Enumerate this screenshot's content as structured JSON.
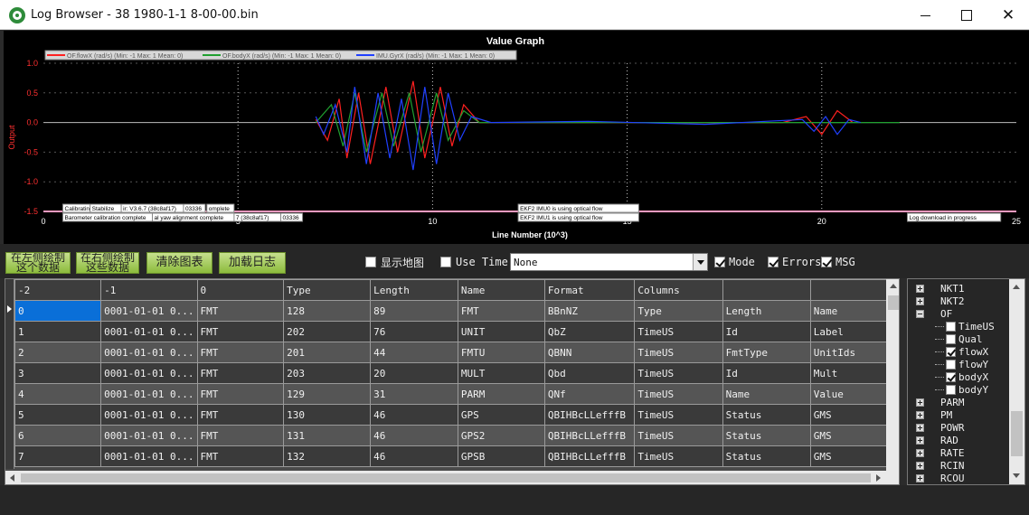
{
  "window": {
    "title": "Log Browser - 38 1980-1-1 8-00-00.bin",
    "close_glyph": "✕"
  },
  "graph": {
    "chart_data": {
      "type": "line",
      "title": "Value Graph",
      "xlabel": "Line Number (10^3)",
      "ylabel": "Output",
      "xlim": [
        0,
        25
      ],
      "ylim": [
        -1.5,
        1.0
      ],
      "x_ticks": [
        "0",
        "5",
        "10",
        "15",
        "20",
        "25"
      ],
      "y_ticks": [
        "1.0",
        "0.5",
        "0.0",
        "-0.5",
        "-1.0",
        "-1.5"
      ],
      "grid": true,
      "legend_position": "top-left",
      "series": [
        {
          "name": "OF.flowX (rad/s) (Min: -1 Max: 1 Mean: 0)",
          "color": "#ff2020",
          "points": [
            [
              7.0,
              0.05
            ],
            [
              7.3,
              -0.3
            ],
            [
              7.6,
              0.4
            ],
            [
              7.8,
              -0.6
            ],
            [
              8.1,
              0.5
            ],
            [
              8.4,
              -0.7
            ],
            [
              8.8,
              0.6
            ],
            [
              9.1,
              -0.5
            ],
            [
              9.5,
              0.7
            ],
            [
              9.8,
              -0.6
            ],
            [
              10.2,
              0.6
            ],
            [
              10.5,
              -0.4
            ],
            [
              10.8,
              0.3
            ],
            [
              11.2,
              0.0
            ],
            [
              13,
              0.0
            ],
            [
              15,
              0.0
            ],
            [
              17,
              0.0
            ],
            [
              19,
              0.0
            ],
            [
              19.6,
              0.1
            ],
            [
              20.0,
              -0.2
            ],
            [
              20.4,
              0.2
            ],
            [
              20.8,
              0.0
            ]
          ]
        },
        {
          "name": "OF.bodyX (rad/s) (Min: -1 Max: 1 Mean: 0)",
          "color": "#20a030",
          "points": [
            [
              7.0,
              0.0
            ],
            [
              7.4,
              0.3
            ],
            [
              7.7,
              -0.4
            ],
            [
              8.0,
              0.5
            ],
            [
              8.3,
              -0.5
            ],
            [
              8.7,
              0.5
            ],
            [
              9.0,
              -0.4
            ],
            [
              9.4,
              0.5
            ],
            [
              9.7,
              -0.5
            ],
            [
              10.1,
              0.5
            ],
            [
              10.4,
              -0.3
            ],
            [
              10.8,
              0.2
            ],
            [
              11.2,
              0.0
            ],
            [
              22,
              0.0
            ]
          ]
        },
        {
          "name": "IMU.GyrX (rad/s) (Min: -1 Max: 1 Mean: 0)",
          "color": "#2040ff",
          "points": [
            [
              7.0,
              0.1
            ],
            [
              7.2,
              -0.2
            ],
            [
              7.5,
              0.3
            ],
            [
              7.8,
              -0.5
            ],
            [
              8.0,
              0.6
            ],
            [
              8.3,
              -0.7
            ],
            [
              8.6,
              0.5
            ],
            [
              8.9,
              -0.6
            ],
            [
              9.2,
              0.4
            ],
            [
              9.5,
              -0.8
            ],
            [
              9.8,
              0.6
            ],
            [
              10.1,
              -0.7
            ],
            [
              10.4,
              0.5
            ],
            [
              10.7,
              -0.3
            ],
            [
              11.0,
              0.1
            ],
            [
              11.5,
              0.0
            ],
            [
              14,
              0.02
            ],
            [
              17,
              -0.03
            ],
            [
              19.5,
              0.05
            ],
            [
              19.8,
              -0.15
            ],
            [
              20.1,
              0.1
            ],
            [
              20.4,
              -0.2
            ],
            [
              20.7,
              0.05
            ],
            [
              21.0,
              0.0
            ]
          ]
        }
      ],
      "annotations": [
        {
          "x": 0.5,
          "text": "Calibrating"
        },
        {
          "x": 1.2,
          "text": "Stabilize"
        },
        {
          "x": 2.0,
          "text": "ir: V3.6.7 (38c8af17)"
        },
        {
          "x": 3.6,
          "text": "03336"
        },
        {
          "x": 4.2,
          "text": "omplete"
        },
        {
          "x": 0.5,
          "text": "Barometer calibration complete"
        },
        {
          "x": 2.8,
          "text": "al yaw alignment complete"
        },
        {
          "x": 4.9,
          "text": "7 (38c8af17)"
        },
        {
          "x": 6.1,
          "text": "03336"
        },
        {
          "x": 12.2,
          "text": "EKF2 IMU0 is using optical flow"
        },
        {
          "x": 12.2,
          "text": "EKF2 IMU1 is using optical flow"
        },
        {
          "x": 22.2,
          "text": "Log download in progress"
        }
      ]
    }
  },
  "toolbar": {
    "btn_left_line1": "在左侧绘制",
    "btn_left_line2": "这个数据",
    "btn_right_line1": "在右侧绘制",
    "btn_right_line2": "这些数据",
    "btn_clear": "清除图表",
    "btn_load_log": "加载日志",
    "show_map_label": "显示地图",
    "use_time_label": "Use Time",
    "time_select_value": "None",
    "mode_label": "Mode",
    "errors_label": "Errors",
    "msg_label": "MSG",
    "checks": {
      "show_map": false,
      "use_time": false,
      "mode": true,
      "errors": true,
      "msg": true
    }
  },
  "table": {
    "headers": [
      "-2",
      "-1",
      "0",
      "Type",
      "Length",
      "Name",
      "Format",
      "Columns",
      "",
      ""
    ],
    "rows": [
      [
        "0",
        "0001-01-01 0...",
        "FMT",
        "128",
        "89",
        "FMT",
        "BBnNZ",
        "Type",
        "Length",
        "Name"
      ],
      [
        "1",
        "0001-01-01 0...",
        "FMT",
        "202",
        "76",
        "UNIT",
        "QbZ",
        "TimeUS",
        "Id",
        "Label"
      ],
      [
        "2",
        "0001-01-01 0...",
        "FMT",
        "201",
        "44",
        "FMTU",
        "QBNN",
        "TimeUS",
        "FmtType",
        "UnitIds"
      ],
      [
        "3",
        "0001-01-01 0...",
        "FMT",
        "203",
        "20",
        "MULT",
        "Qbd",
        "TimeUS",
        "Id",
        "Mult"
      ],
      [
        "4",
        "0001-01-01 0...",
        "FMT",
        "129",
        "31",
        "PARM",
        "QNf",
        "TimeUS",
        "Name",
        "Value"
      ],
      [
        "5",
        "0001-01-01 0...",
        "FMT",
        "130",
        "46",
        "GPS",
        "QBIHBcLLefffB",
        "TimeUS",
        "Status",
        "GMS"
      ],
      [
        "6",
        "0001-01-01 0...",
        "FMT",
        "131",
        "46",
        "GPS2",
        "QBIHBcLLefffB",
        "TimeUS",
        "Status",
        "GMS"
      ],
      [
        "7",
        "0001-01-01 0...",
        "FMT",
        "132",
        "46",
        "GPSB",
        "QBIHBcLLefffB",
        "TimeUS",
        "Status",
        "GMS"
      ]
    ]
  },
  "tree": {
    "items": [
      {
        "label": "NKT1",
        "kind": "node",
        "expanded": false
      },
      {
        "label": "NKT2",
        "kind": "node",
        "expanded": false
      },
      {
        "label": "OF",
        "kind": "node",
        "expanded": true
      },
      {
        "label": "TimeUS",
        "kind": "leaf",
        "checked": false
      },
      {
        "label": "Qual",
        "kind": "leaf",
        "checked": false
      },
      {
        "label": "flowX",
        "kind": "leaf",
        "checked": true
      },
      {
        "label": "flowY",
        "kind": "leaf",
        "checked": false
      },
      {
        "label": "bodyX",
        "kind": "leaf",
        "checked": true
      },
      {
        "label": "bodyY",
        "kind": "leaf",
        "checked": false
      },
      {
        "label": "PARM",
        "kind": "node",
        "expanded": false
      },
      {
        "label": "PM",
        "kind": "node",
        "expanded": false
      },
      {
        "label": "POWR",
        "kind": "node",
        "expanded": false
      },
      {
        "label": "RAD",
        "kind": "node",
        "expanded": false
      },
      {
        "label": "RATE",
        "kind": "node",
        "expanded": false
      },
      {
        "label": "RCIN",
        "kind": "node",
        "expanded": false
      },
      {
        "label": "RCOU",
        "kind": "node",
        "expanded": false
      }
    ]
  }
}
